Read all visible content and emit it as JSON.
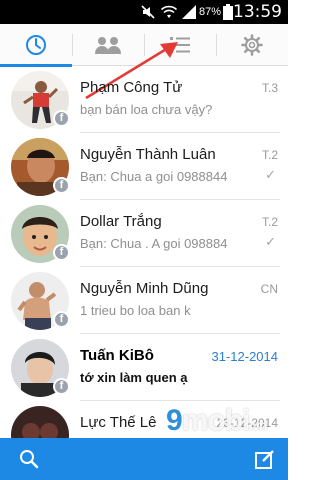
{
  "status_bar": {
    "battery_percent": "87%",
    "time": "13:59"
  },
  "tabs": [
    {
      "name": "recent",
      "icon": "clock-icon",
      "active": true
    },
    {
      "name": "groups",
      "icon": "group-icon",
      "active": false
    },
    {
      "name": "people",
      "icon": "list-icon",
      "active": false
    },
    {
      "name": "settings",
      "icon": "gear-icon",
      "active": false
    }
  ],
  "conversations": [
    {
      "name": "Phạm Công Tử",
      "preview": "bạn bán loa chưa vậy?",
      "time": "T.3",
      "status": "",
      "unread": false
    },
    {
      "name": "Nguyễn Thành Luân",
      "preview": "Bạn: Chua a goi 0988844",
      "time": "T.2",
      "status": "✓",
      "unread": false
    },
    {
      "name": "Dollar Trắng",
      "preview": "Bạn: Chua . A goi 098884",
      "time": "T.2",
      "status": "✓",
      "unread": false
    },
    {
      "name": "Nguyễn Minh Dũng",
      "preview": "1 trieu bo loa ban k",
      "time": "CN",
      "status": "",
      "unread": false
    },
    {
      "name": "Tuấn KiBô",
      "preview": "tớ xin làm quen ạ",
      "time": "31-12-2014",
      "status": "",
      "unread": true
    },
    {
      "name": "Lực Thế Lê",
      "preview": "",
      "time": "23-12-2014",
      "status": "",
      "unread": false
    }
  ],
  "watermark": {
    "nine": "9",
    "text": "mobi",
    "suffix": ".vn"
  },
  "colors": {
    "accent": "#1e88e5",
    "arrow": "#e53935"
  }
}
